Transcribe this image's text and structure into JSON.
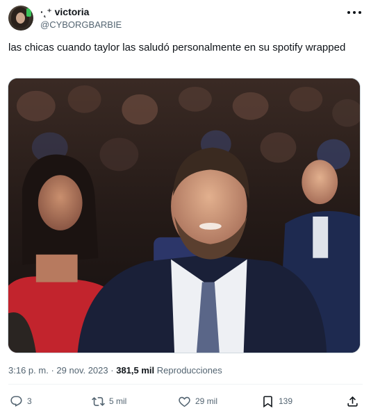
{
  "author": {
    "display_name": "·˛⁺ victoria",
    "handle": "@CYBORGBARBIE"
  },
  "tweet": {
    "text": "las chicas cuando taylor las saludó personalmente en su spotify wrapped"
  },
  "meta": {
    "time": "3:16 p. m.",
    "separator": "·",
    "date": "29 nov. 2023",
    "views_count": "381,5 mil",
    "views_label": "Reproducciones"
  },
  "actions": {
    "replies": "3",
    "retweets": "5 mil",
    "likes": "29 mil",
    "bookmarks": "139"
  },
  "icons": {
    "more": "more-horizontal-icon",
    "reply": "reply-icon",
    "retweet": "retweet-icon",
    "like": "heart-icon",
    "bookmark": "bookmark-icon",
    "share": "share-icon"
  },
  "colors": {
    "text_primary": "#0f1419",
    "text_secondary": "#536471",
    "border": "#cfd9de"
  }
}
